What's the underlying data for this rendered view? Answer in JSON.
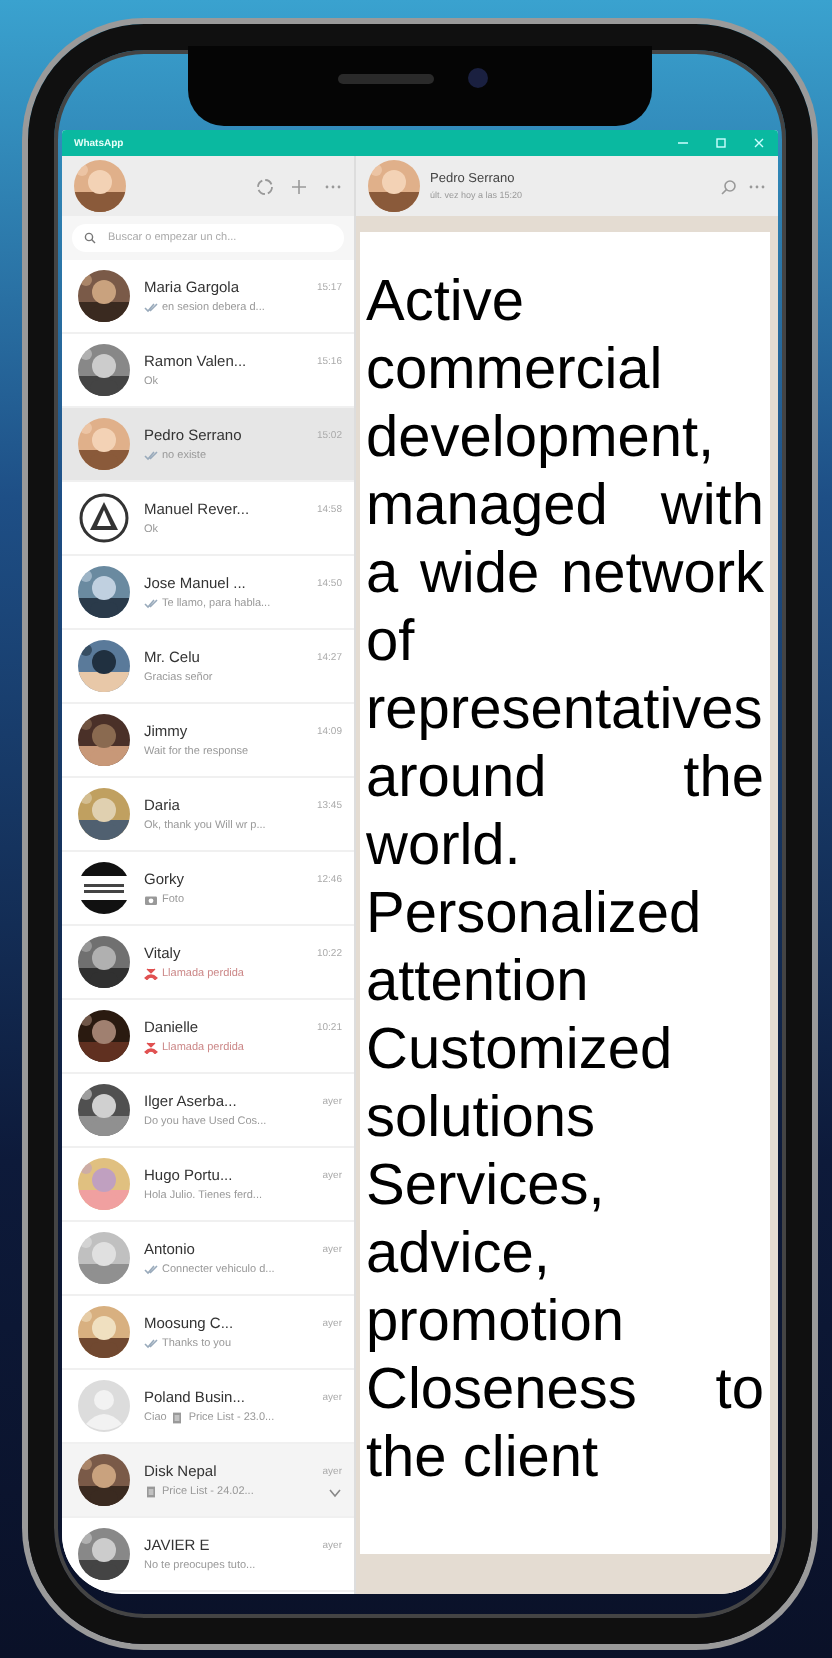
{
  "window": {
    "title": "WhatsApp"
  },
  "sidebar": {
    "search": {
      "placeholder": "Buscar o empezar un ch..."
    },
    "chats": [
      {
        "name": "Maria Gargola",
        "time": "15:17",
        "preview": "en sesion debera d...",
        "status": {
          "kind": "read"
        },
        "selected": false,
        "hovered": false
      },
      {
        "name": "Ramon Valen...",
        "time": "15:16",
        "preview": "Ok",
        "selected": false,
        "hovered": false
      },
      {
        "name": "Pedro Serrano",
        "time": "15:02",
        "preview": "no existe",
        "status": {
          "kind": "read"
        },
        "selected": true,
        "hovered": false
      },
      {
        "name": "Manuel Rever...",
        "time": "14:58",
        "preview": "Ok",
        "avatar": {
          "kind": "triangle_logo"
        },
        "selected": false,
        "hovered": false
      },
      {
        "name": "Jose Manuel ...",
        "time": "14:50",
        "preview": "Te llamo, para habla...",
        "status": {
          "kind": "read"
        },
        "selected": false,
        "hovered": false
      },
      {
        "name": "Mr. Celu",
        "time": "14:27",
        "preview": "Gracias señor",
        "selected": false,
        "hovered": false
      },
      {
        "name": "Jimmy",
        "time": "14:09",
        "preview": "Wait for the response",
        "selected": false,
        "hovered": false
      },
      {
        "name": "Daria",
        "time": "13:45",
        "preview": "Ok, thank you Will wr p...",
        "selected": false,
        "hovered": false
      },
      {
        "name": "Gorky",
        "time": "12:46",
        "preview": "Foto",
        "avatar": {
          "kind": "stripe_logo"
        },
        "selected": false,
        "hovered": false
      },
      {
        "name": "Vitaly",
        "time": "10:22",
        "preview": "Llamada perdida",
        "status": {
          "kind": "missed_call"
        },
        "selected": false,
        "hovered": false
      },
      {
        "name": "Danielle",
        "time": "10:21",
        "preview": "Llamada perdida",
        "status": {
          "kind": "missed_call"
        },
        "selected": false,
        "hovered": false
      },
      {
        "name": "Ilger Aserba...",
        "time": "ayer",
        "preview": "Do you have Used Cos...",
        "selected": false,
        "hovered": false
      },
      {
        "name": "Hugo Portu...",
        "time": "ayer",
        "preview": "Hola Julio. Tienes ferd...",
        "selected": false,
        "hovered": false
      },
      {
        "name": "Antonio",
        "time": "ayer",
        "preview": "Connecter vehiculo d...",
        "status": {
          "kind": "read"
        },
        "selected": false,
        "hovered": false
      },
      {
        "name": "Moosung C...",
        "time": "ayer",
        "preview": "Thanks to you",
        "status": {
          "kind": "read"
        },
        "selected": false,
        "hovered": false
      },
      {
        "name": "Poland Busin...",
        "time": "ayer",
        "prefix": "Ciao",
        "preview": "Price List - 23.0...",
        "status": {
          "kind": "document"
        },
        "avatar": {
          "kind": "placeholder"
        },
        "selected": false,
        "hovered": false
      },
      {
        "name": "Disk Nepal",
        "time": "ayer",
        "preview": "Price List - 24.02...",
        "status": {
          "kind": "document"
        },
        "selected": false,
        "hovered": true
      },
      {
        "name": "JAVIER E",
        "time": "ayer",
        "preview": "No te preocupes tuto...",
        "selected": false,
        "hovered": false
      }
    ]
  },
  "conversation": {
    "name": "Pedro Serrano",
    "subtitle": "últ. vez hoy a las 15:20"
  },
  "overlay": {
    "paragraphs": [
      "Active commercial development, managed with a wide network of representatives around the world.",
      "Personalized attention",
      "Customized solutions",
      "Services, advice, promotion",
      "Closeness to the client"
    ]
  }
}
